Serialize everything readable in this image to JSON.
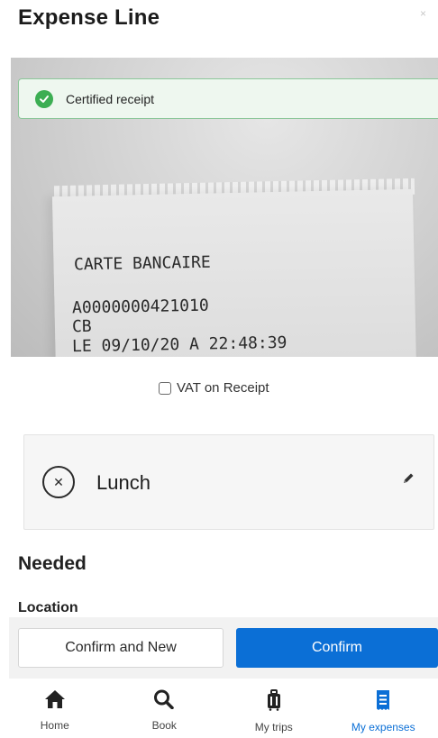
{
  "header": {
    "title": "Expense Line",
    "close_glyph": "×"
  },
  "receipt": {
    "banner_label": "Certified receipt",
    "image_text_lines": [
      "CARTE BANCAIRE",
      "A0000000421010",
      "CB",
      "LE 09/10/20 A 22:48:39"
    ]
  },
  "vat": {
    "label": "VAT on Receipt",
    "checked": false
  },
  "category": {
    "label": "Lunch",
    "icon": "close-circle-icon",
    "edit_icon": "pencil-icon"
  },
  "needed": {
    "title": "Needed",
    "location_label": "Location"
  },
  "actions": {
    "confirm_new_label": "Confirm and New",
    "confirm_label": "Confirm"
  },
  "tabs": [
    {
      "label": "Home",
      "icon": "home-icon",
      "active": false
    },
    {
      "label": "Book",
      "icon": "search-icon",
      "active": false
    },
    {
      "label": "My trips",
      "icon": "luggage-icon",
      "active": false
    },
    {
      "label": "My expenses",
      "icon": "receipt-icon",
      "active": true
    }
  ],
  "colors": {
    "accent": "#0b6fd6",
    "success": "#3cae53",
    "banner_bg": "#eef7ef"
  }
}
